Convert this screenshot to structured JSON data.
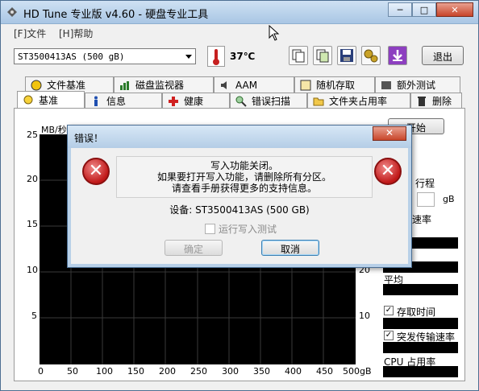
{
  "window": {
    "title": "HD Tune 专业版 v4.60 - 硬盘专业工具",
    "min": "─",
    "max": "□",
    "close": "✕"
  },
  "menu": {
    "file": "[F]文件",
    "help": "[H]帮助"
  },
  "toolbar": {
    "drive": "ST3500413AS (500 gB)",
    "temperature": "37℃",
    "exit": "退出"
  },
  "tabs_top": [
    "文件基准",
    "磁盘监视器",
    "AAM",
    "随机存取",
    "额外测试"
  ],
  "tabs_bottom": [
    "基准",
    "信息",
    "健康",
    "错误扫描",
    "文件夹占用率",
    "删除"
  ],
  "chart": {
    "ylabel": "MB/秒",
    "yticks": [
      "25",
      "20",
      "15",
      "10",
      "5"
    ],
    "xticks": [
      "0",
      "50",
      "100",
      "150",
      "200",
      "250",
      "300",
      "350",
      "400",
      "450",
      "500gB"
    ],
    "right_ticks": [
      "20",
      "10"
    ]
  },
  "side": {
    "start": "开始",
    "tests_partial": "行程",
    "unit_partial": "gB",
    "rate_partial": "速率",
    "avg_label": "平均",
    "access_time": "存取时间",
    "burst": "突发传输速率",
    "cpu": "CPU 占用率"
  },
  "dialog": {
    "title": "错误！",
    "close": "✕",
    "line1": "写入功能关闭。",
    "line2": "如果要打开写入功能，请删除所有分区。",
    "line3": "请查看手册获得更多的支持信息。",
    "device": "设备: ST3500413AS (500 GB)",
    "write_test": "运行写入测试",
    "ok": "确定",
    "cancel": "取消"
  }
}
